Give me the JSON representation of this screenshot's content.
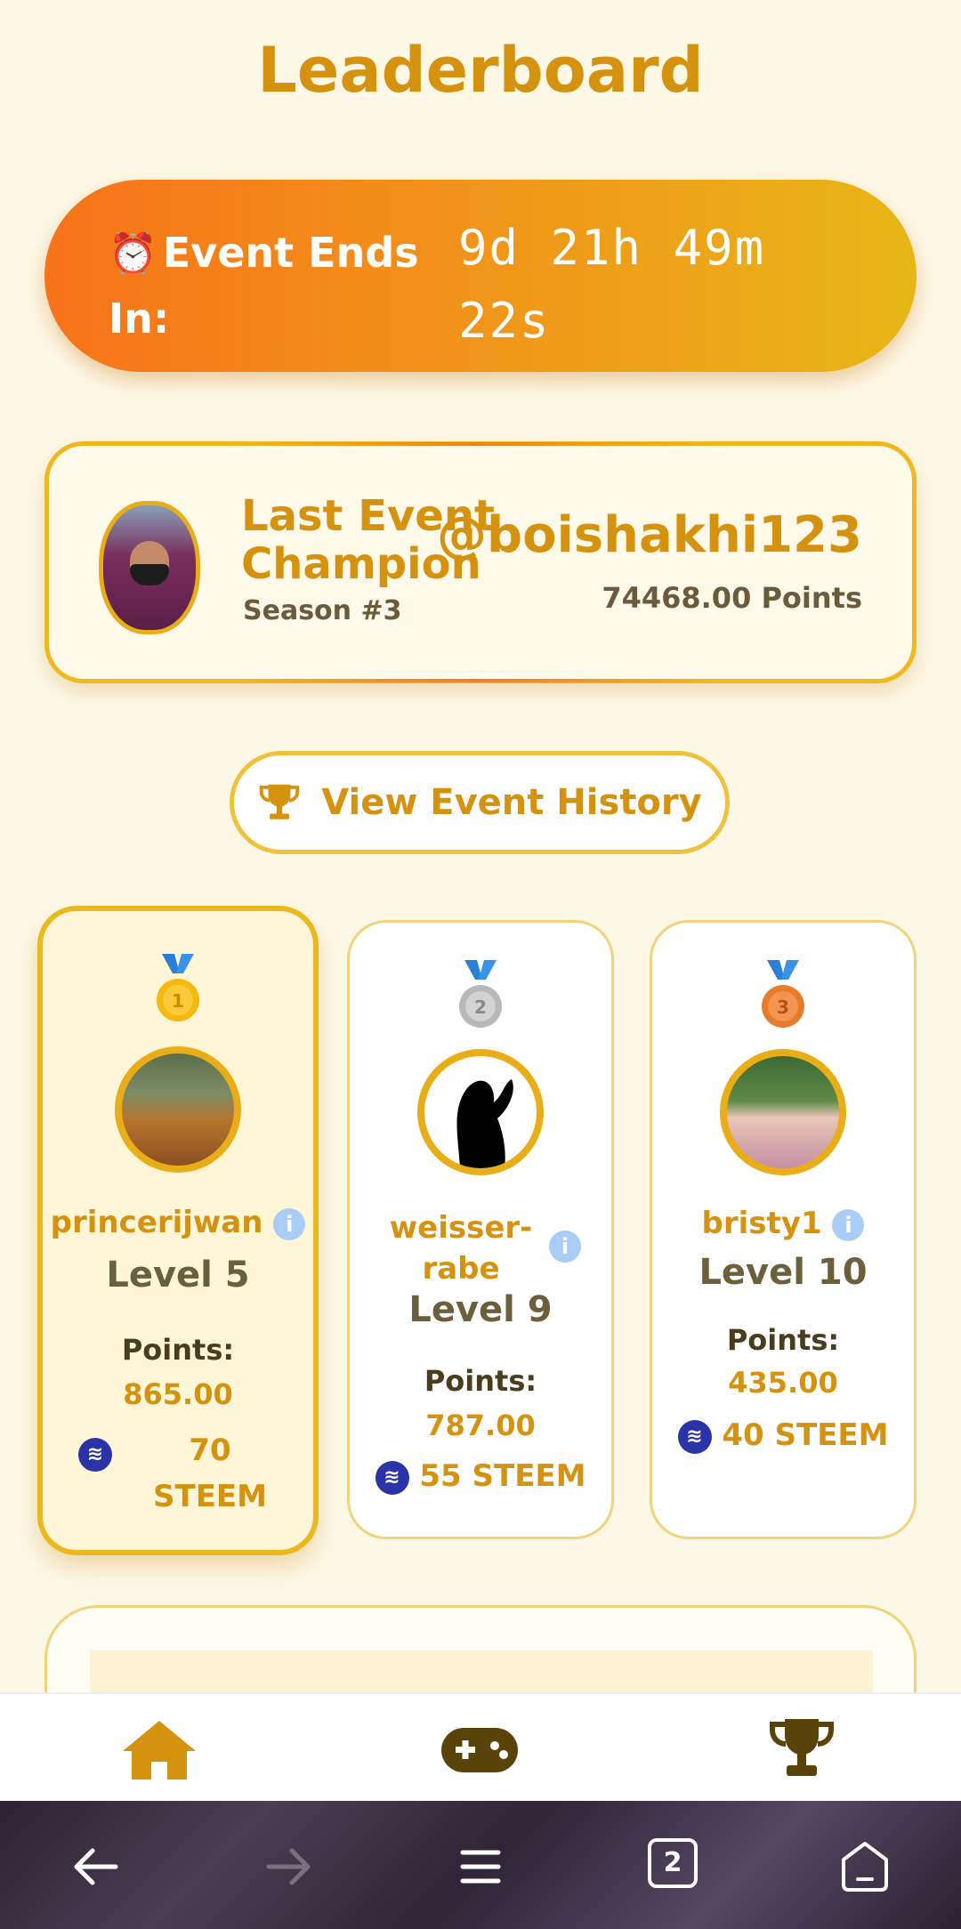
{
  "page": {
    "title": "Leaderboard"
  },
  "timer": {
    "icon": "alarm-clock-icon",
    "label": "Event Ends In:",
    "line1": "9d 21h 49m",
    "line2": "22s"
  },
  "champion": {
    "heading": "Last Event Champion",
    "season": "Season #3",
    "handle": "@boishakhi123",
    "points": "74468.00 Points"
  },
  "history_button": {
    "icon": "trophy-icon",
    "label": "View Event History"
  },
  "podium": [
    {
      "rank": 1,
      "medal_color": "#f5b80c",
      "username": "princerijwan",
      "level": "Level 5",
      "points_label": "Points:",
      "points": "865.00",
      "reward": "70 STEEM"
    },
    {
      "rank": 2,
      "medal_color": "#b8b8b8",
      "username": "weisser-rabe",
      "level": "Level 9",
      "points_label": "Points:",
      "points": "787.00",
      "reward": "55 STEEM"
    },
    {
      "rank": 3,
      "medal_color": "#e87a2a",
      "username": "bristy1",
      "level": "Level 10",
      "points_label": "Points:",
      "points": "435.00",
      "reward": "40 STEEM"
    }
  ],
  "bottom_nav": [
    {
      "name": "home-icon",
      "color": "#d4920f"
    },
    {
      "name": "gamepad-icon",
      "color": "#5a4308"
    },
    {
      "name": "trophy-icon",
      "color": "#5a4308"
    }
  ],
  "system_nav": {
    "tab_count": "2"
  }
}
